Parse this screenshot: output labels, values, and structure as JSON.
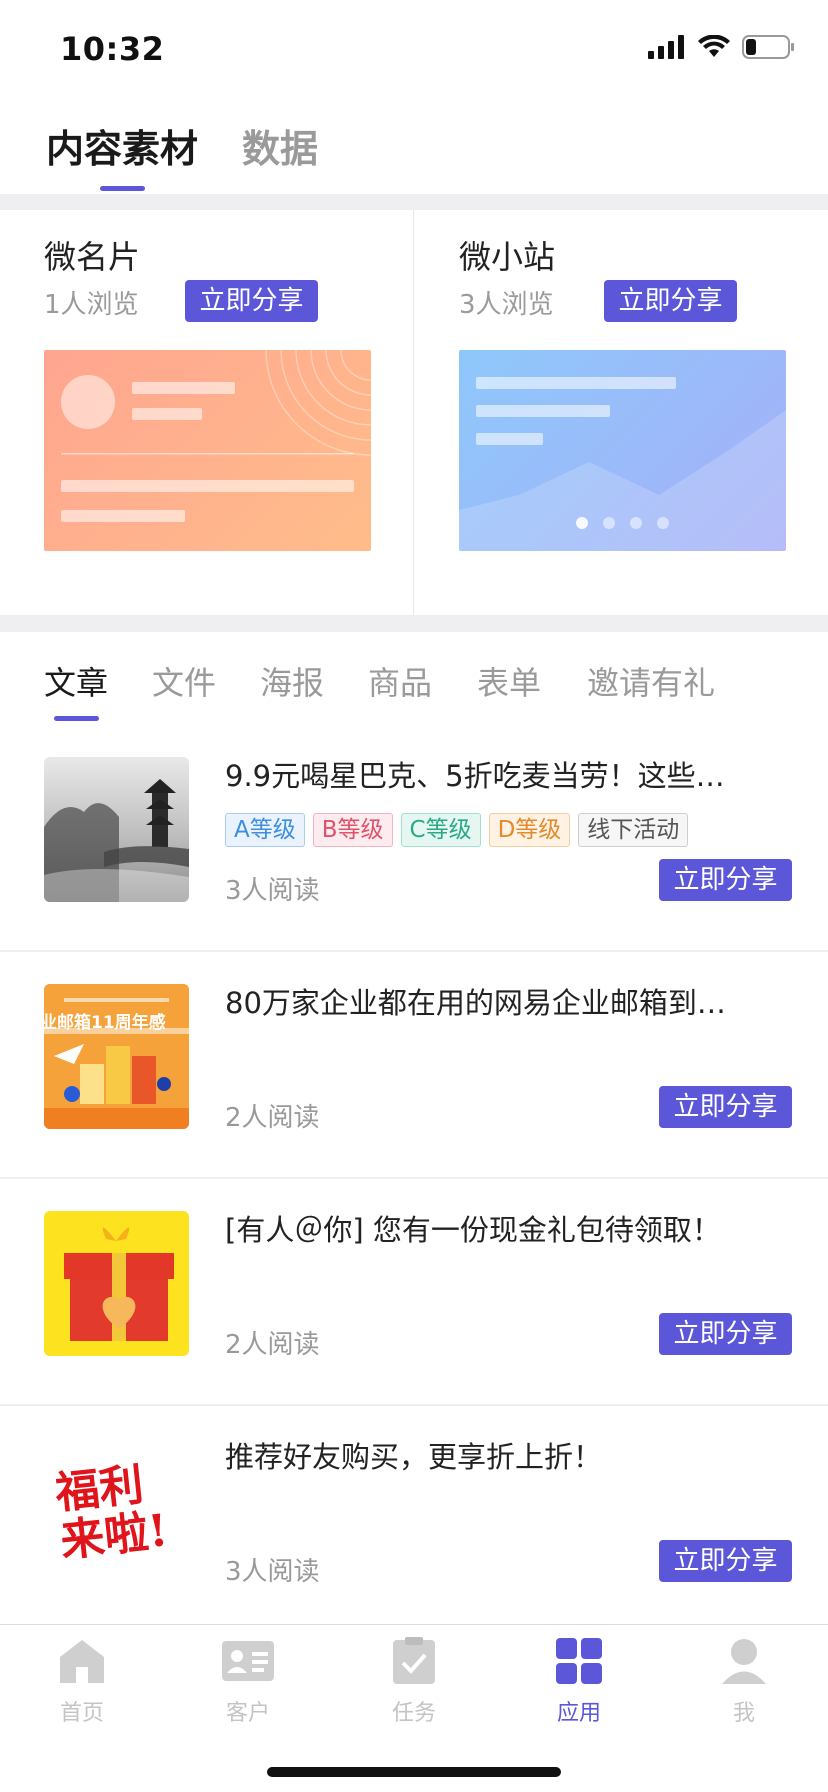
{
  "status": {
    "time": "10:32"
  },
  "top_tabs": [
    {
      "label": "内容素材",
      "active": true
    },
    {
      "label": "数据",
      "active": false
    }
  ],
  "quick_cards": [
    {
      "title": "微名片",
      "views": "1人浏览",
      "share_label": "立即分享"
    },
    {
      "title": "微小站",
      "views": "3人浏览",
      "share_label": "立即分享"
    }
  ],
  "sub_tabs": [
    {
      "label": "文章",
      "active": true
    },
    {
      "label": "文件",
      "active": false
    },
    {
      "label": "海报",
      "active": false
    },
    {
      "label": "商品",
      "active": false
    },
    {
      "label": "表单",
      "active": false
    },
    {
      "label": "邀请有礼",
      "active": false
    }
  ],
  "articles": [
    {
      "title": "9.9元喝星巴克、5折吃麦当劳！这些…",
      "tags": [
        {
          "label": "A等级",
          "color": "#3d8fe0",
          "bg": "#eaf3fd",
          "border": "#a9cdf4"
        },
        {
          "label": "B等级",
          "color": "#e0526a",
          "bg": "#fdecef",
          "border": "#f4b3bf"
        },
        {
          "label": "C等级",
          "color": "#2aa98a",
          "bg": "#e6f7f2",
          "border": "#a3e0cf"
        },
        {
          "label": "D等级",
          "color": "#e58a2a",
          "bg": "#fdf2e4",
          "border": "#f4cf9f"
        },
        {
          "label": "线下活动",
          "color": "#555555",
          "bg": "#f6f6f6",
          "border": "#cfcfcf"
        }
      ],
      "reads": "3人阅读",
      "share_label": "立即分享",
      "thumb_icon": "landscape-pagoda-image"
    },
    {
      "title": "80万家企业都在用的网易企业邮箱到…",
      "tags": [],
      "reads": "2人阅读",
      "share_label": "立即分享",
      "thumb_icon": "mail-anniversary-poster",
      "thumb_text": "业邮箱11周年感"
    },
    {
      "title": "[有人＠你] 您有一份现金礼包待领取！",
      "tags": [],
      "reads": "2人阅读",
      "share_label": "立即分享",
      "thumb_icon": "gift-box-image"
    },
    {
      "title": "推荐好友购买，更享折上折！",
      "tags": [],
      "reads": "3人阅读",
      "share_label": "立即分享",
      "thumb_icon": "welfare-calligraphy-image",
      "thumb_text": "福利来啦!"
    }
  ],
  "tab_bar": [
    {
      "label": "首页",
      "icon": "home-icon",
      "active": false
    },
    {
      "label": "客户",
      "icon": "contact-card-icon",
      "active": false
    },
    {
      "label": "任务",
      "icon": "task-check-icon",
      "active": false
    },
    {
      "label": "应用",
      "icon": "apps-grid-icon",
      "active": true
    },
    {
      "label": "我",
      "icon": "user-icon",
      "active": false
    }
  ],
  "colors": {
    "accent": "#5b57d8",
    "inactive": "#c4c4c4"
  }
}
